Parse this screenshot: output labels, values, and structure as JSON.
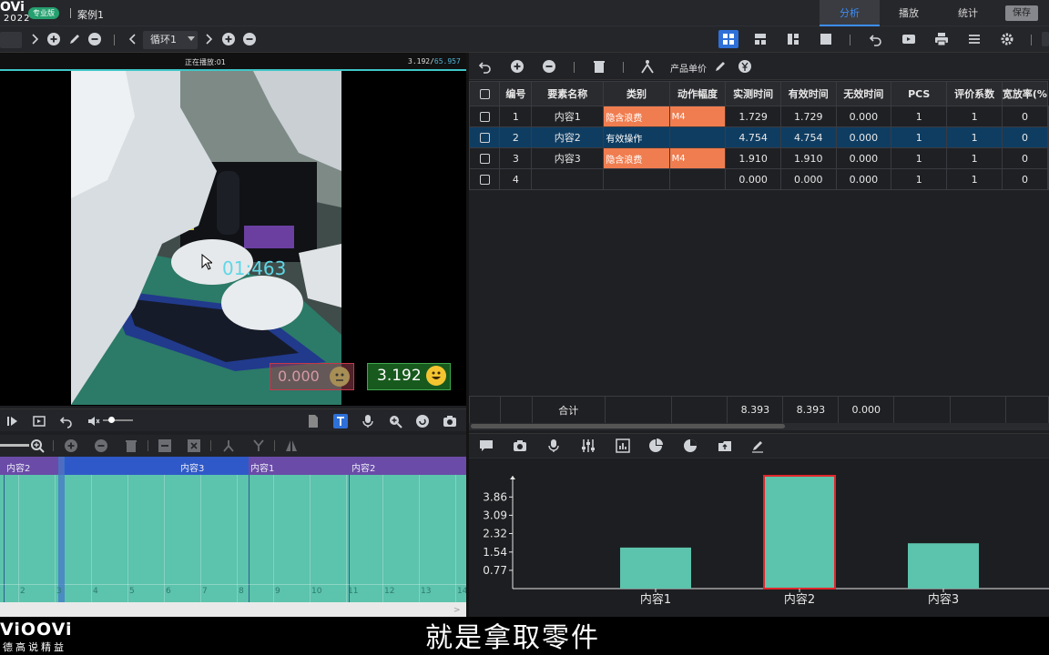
{
  "app": {
    "logo": "OVi",
    "year": "2022",
    "edition": "专业版",
    "case_name": "案例1"
  },
  "top_tabs": [
    {
      "label": "分析",
      "active": true
    },
    {
      "label": "播放",
      "active": false
    },
    {
      "label": "统计",
      "active": false
    }
  ],
  "save_label": "保存",
  "toolbar": {
    "loop_value": "循环1"
  },
  "video": {
    "playing_label": "正在播放:01",
    "time_current": "3.192/",
    "time_total": "65.957",
    "overlay_timer": "01:463",
    "invalid_time": "0.000",
    "valid_time": "3.192"
  },
  "timeline": {
    "segments": [
      {
        "label": "内容2"
      },
      {
        "label": "内容3"
      },
      {
        "label": "内容1"
      },
      {
        "label": "内容2"
      }
    ],
    "ticks": [
      "2",
      "3",
      "4",
      "5",
      "6",
      "7",
      "8",
      "9",
      "10",
      "11",
      "12",
      "13",
      "14"
    ]
  },
  "table_toolbar": {
    "unit_price_label": "产品单价"
  },
  "table": {
    "columns": [
      "编号",
      "要素名称",
      "类别",
      "动作幅度",
      "实测时间",
      "有效时间",
      "无效时间",
      "PCS",
      "评价系数",
      "宽放率(%"
    ],
    "rows": [
      {
        "no": "1",
        "name": "内容1",
        "category": "隐含浪费",
        "amplitude": "M4",
        "measured": "1.729",
        "valid": "1.729",
        "invalid": "0.000",
        "pcs": "1",
        "coef": "1",
        "allow": "0",
        "cat_class": "waste",
        "selected": false
      },
      {
        "no": "2",
        "name": "内容2",
        "category": "有效操作",
        "amplitude": "",
        "measured": "4.754",
        "valid": "4.754",
        "invalid": "0.000",
        "pcs": "1",
        "coef": "1",
        "allow": "0",
        "cat_class": "valid",
        "selected": true
      },
      {
        "no": "3",
        "name": "内容3",
        "category": "隐含浪费",
        "amplitude": "M4",
        "measured": "1.910",
        "valid": "1.910",
        "invalid": "0.000",
        "pcs": "1",
        "coef": "1",
        "allow": "0",
        "cat_class": "waste",
        "selected": false
      },
      {
        "no": "4",
        "name": "",
        "category": "",
        "amplitude": "",
        "measured": "0.000",
        "valid": "0.000",
        "invalid": "0.000",
        "pcs": "1",
        "coef": "1",
        "allow": "0",
        "cat_class": "",
        "selected": false
      }
    ],
    "total": {
      "label": "合计",
      "measured": "8.393",
      "valid": "8.393",
      "invalid": "0.000"
    }
  },
  "chart_data": {
    "type": "bar",
    "categories": [
      "内容1",
      "内容2",
      "内容3"
    ],
    "values": [
      1.729,
      4.754,
      1.91
    ],
    "highlighted": "内容2",
    "y_ticks": [
      "0.77",
      "1.54",
      "2.32",
      "3.09",
      "3.86"
    ],
    "ylim": [
      0,
      4.754
    ],
    "bar_color": "#5cc3ac",
    "highlight_border": "#e0262b"
  },
  "subtitle": {
    "text": "就是拿取零件",
    "brand": "ViOOVi",
    "brand_sub": "德高说精益"
  }
}
